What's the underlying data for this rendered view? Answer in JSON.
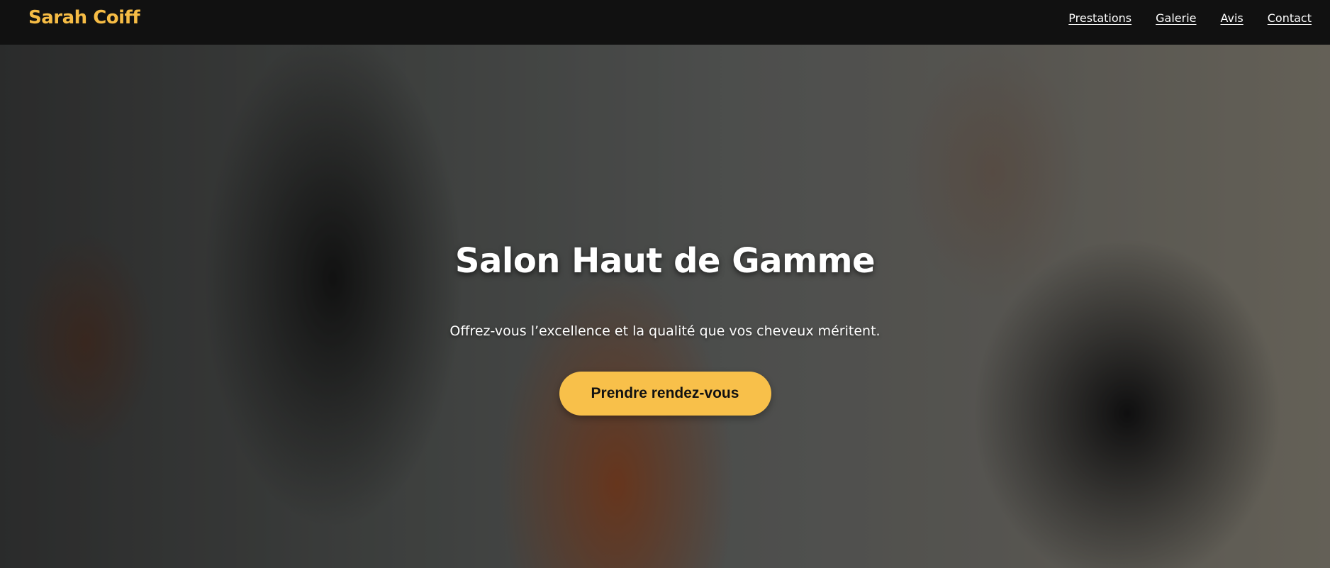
{
  "brand": {
    "name": "Sarah Coiff",
    "color": "#f6bc45"
  },
  "nav": {
    "items": [
      {
        "label": "Prestations"
      },
      {
        "label": "Galerie"
      },
      {
        "label": "Avis"
      },
      {
        "label": "Contact"
      }
    ]
  },
  "hero": {
    "title": "Salon Haut de Gamme",
    "subtitle": "Offrez-vous l’excellence et la qualité que vos cheveux méritent.",
    "cta_label": "Prendre rendez-vous",
    "cta_color": "#f8c04a",
    "background_image": "hairdresser-blow-drying-photo"
  },
  "colors": {
    "header_background": "#111111",
    "text": "#ffffff"
  }
}
